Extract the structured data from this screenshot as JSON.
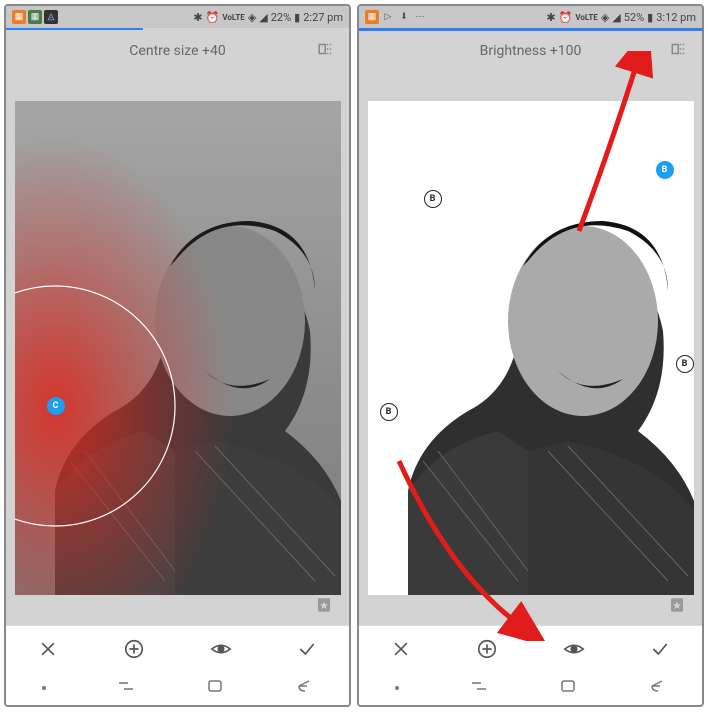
{
  "left": {
    "status": {
      "battery_pct": "22%",
      "time": "2:27 pm"
    },
    "adjustment_label": "Centre size +40",
    "point_label": "C"
  },
  "right": {
    "status": {
      "battery_pct": "52%",
      "time": "3:12 pm"
    },
    "adjustment_label": "Brightness +100",
    "point_label": "B"
  },
  "toolbar": {
    "close": "×",
    "add": "+",
    "view": "👁",
    "confirm": "✓"
  }
}
